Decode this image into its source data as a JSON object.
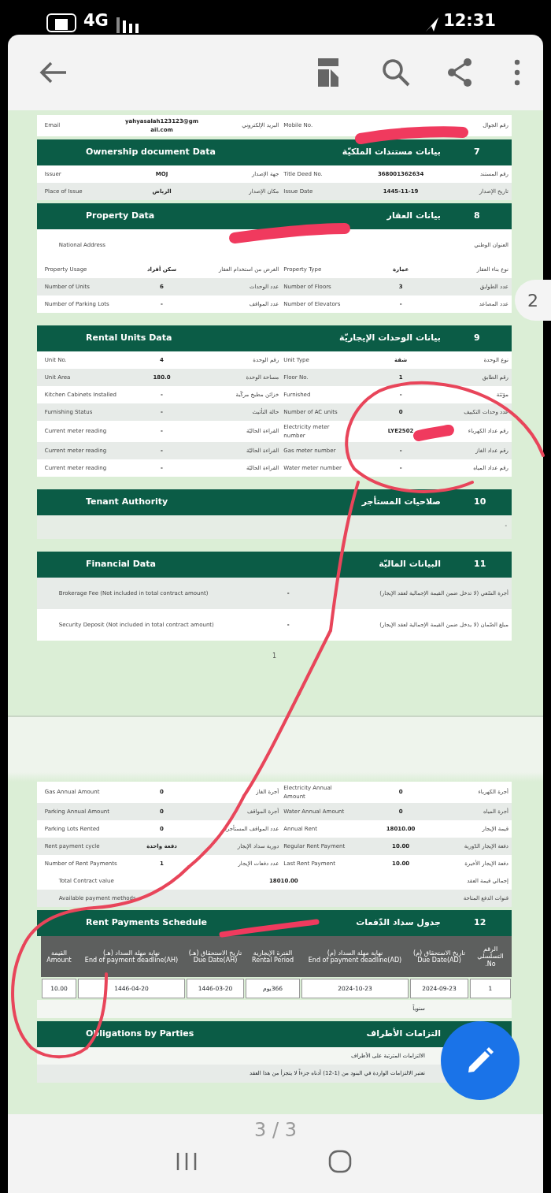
{
  "status_bar": {
    "network": "4G",
    "time": "12:31"
  },
  "pages": [
    {
      "blocks": [
        {
          "kind": "pair",
          "cells": [
            "رقم الجوال",
            null,
            "Mobile No.",
            "البريد الإلكتروني",
            "yahyasalah123123@gmail.com",
            "Email"
          ]
        },
        {
          "kind": "header",
          "number": "7",
          "title_ar": "بيانات مستندات الملكيّة",
          "title_en": "Ownership document Data"
        },
        {
          "kind": "pair",
          "cells": [
            "رقم المستند",
            "368001362634",
            "Title Deed No.",
            "جهة الإصدار",
            "MOJ",
            "Issuer"
          ]
        },
        {
          "kind": "pair",
          "cells": [
            "تاريخ الإصدار",
            "1445-11-19",
            "Issue Date",
            "مكان الإصدار",
            "الرياض",
            "Place of Issue"
          ]
        },
        {
          "kind": "header",
          "number": "8",
          "title_ar": "بيانات العقار",
          "title_en": "Property Data"
        },
        {
          "kind": "wide",
          "cells": [
            "العنوان الوطني",
            null,
            "National Address"
          ]
        },
        {
          "kind": "pair",
          "cells": [
            "نوع بناء العقار",
            "عمارة",
            "Property Type",
            "الغرض من استخدام العقار",
            "سكن أفراد",
            "Property Usage"
          ]
        },
        {
          "kind": "pair",
          "cells": [
            "عدد الطوابق",
            "3",
            "Number of Floors",
            "عدد الوحدات",
            "6",
            "Number of Units"
          ]
        },
        {
          "kind": "pair",
          "cells": [
            "عدد المصاعد",
            "-",
            "Number of Elevators",
            "عدد المواقف",
            "-",
            "Number of Parking Lots"
          ]
        },
        {
          "kind": "gap"
        },
        {
          "kind": "header",
          "number": "9",
          "title_ar": "بيانات الوحدات الإيجاريّة",
          "title_en": "Rental Units Data"
        },
        {
          "kind": "pair",
          "cells": [
            "نوع الوحدة",
            "شقة",
            "Unit Type",
            "رقم الوحدة",
            "4",
            "Unit No."
          ]
        },
        {
          "kind": "pair",
          "cells": [
            "رقم الطابق",
            "1",
            "Floor No.",
            "مساحة الوحدة",
            "180.0",
            "Unit Area"
          ]
        },
        {
          "kind": "pair",
          "cells": [
            "مؤثثة",
            "-",
            "Furnished",
            "خزائن مطبخ مركّبة",
            "-",
            "Kitchen Cabinets Installed"
          ]
        },
        {
          "kind": "pair",
          "cells": [
            "عدد وحدات التكييف",
            "0",
            "Number of AC units",
            "حالة التأثيث",
            "-",
            "Furnishing Status"
          ]
        },
        {
          "kind": "pair",
          "cells": [
            "رقم عداد الكهرباء",
            "LYE2502",
            "Electricity meter number",
            "القراءة الحاليّة",
            "-",
            "Current meter reading"
          ]
        },
        {
          "kind": "pair",
          "cells": [
            "رقم عداد الغاز",
            "-",
            "Gas meter number",
            "القراءة الحاليّة",
            "-",
            "Current meter reading"
          ]
        },
        {
          "kind": "pair",
          "cells": [
            "رقم عداد المياه",
            "-",
            "Water meter number",
            "القراءة الحاليّة",
            "-",
            "Current meter reading"
          ]
        },
        {
          "kind": "gap"
        },
        {
          "kind": "header",
          "number": "10",
          "title_ar": "صلاحيات المستأجر",
          "title_en": "Tenant Authority"
        },
        {
          "kind": "blank",
          "text": "-"
        },
        {
          "kind": "gap"
        },
        {
          "kind": "header",
          "number": "11",
          "title_ar": "البيانات الماليّة",
          "title_en": "Financial Data"
        },
        {
          "kind": "wide",
          "cells": [
            "أجرة السّعي (لا تدخل ضمن القيمة الإجمالية لعقد الإيجار)",
            "-",
            "Brokerage Fee (Not included in total contract amount)"
          ]
        },
        {
          "kind": "wide",
          "cells": [
            "مبلغ الضّمان (لا يدخل ضمن القيمة الإجمالية لعقد الإيجار)",
            "-",
            "Security Deposit (Not included in total contract amount)"
          ]
        }
      ],
      "page_number": "1"
    },
    {
      "blocks": [
        {
          "kind": "pair",
          "cells": [
            "أجرة الكهرباء",
            "0",
            "Electricity Annual Amount",
            "أجرة الغاز",
            "0",
            "Gas Annual Amount"
          ]
        },
        {
          "kind": "pair",
          "cells": [
            "أجرة المياه",
            "0",
            "Water Annual Amount",
            "أجرة المواقف",
            "0",
            "Parking Annual Amount"
          ]
        },
        {
          "kind": "pair",
          "cells": [
            "قيمة الإيجار",
            "18010.00",
            "Annual Rent",
            "عدد المواقف المستأجرة",
            "0",
            "Parking Lots Rented"
          ]
        },
        {
          "kind": "pair",
          "cells": [
            "دفعة الإيجار الدّورية",
            "10.00",
            "Regular Rent Payment",
            "دورية سداد الإيجار",
            "دفعة واحدة",
            "Rent payment cycle"
          ]
        },
        {
          "kind": "pair",
          "cells": [
            "دفعة الإيجار الأخيرة",
            "10.00",
            "Last Rent Payment",
            "عدد دفعات الإيجار",
            "1",
            "Number of Rent Payments"
          ]
        },
        {
          "kind": "total",
          "cells": [
            "إجمالي قيمة العقد",
            "18010.00",
            "Total Contract value"
          ]
        },
        {
          "kind": "total",
          "cells": [
            "قنوات الدفع المتاحة",
            null,
            "Available payment methods"
          ]
        },
        {
          "kind": "header",
          "number": "12",
          "title_ar": "جدول سداد الدّفعات",
          "title_en": "Rent Payments Schedule"
        },
        {
          "kind": "schedule",
          "columns": [
            {
              "ar": "الرقم التسلسلي",
              "en": "No."
            },
            {
              "ar": "تاريخ الاستحقاق (م)",
              "en": "Due Date(AD)"
            },
            {
              "ar": "نهاية مهلة السداد (م)",
              "en": "End of payment deadline(AD)"
            },
            {
              "ar": "الفترة الإيجارية",
              "en": "Rental Period"
            },
            {
              "ar": "تاريخ الاستحقاق (هـ)",
              "en": "Due Date(AH)"
            },
            {
              "ar": "نهاية مهلة السداد (هـ)",
              "en": "End of payment deadline(AH)"
            },
            {
              "ar": "القيمة",
              "en": "Amount"
            }
          ],
          "rows": [
            [
              "1",
              "2024-09-23",
              "2024-10-23",
              "366يوم",
              "1446-03-20",
              "1446-04-20",
              "10.00"
            ]
          ]
        },
        {
          "kind": "note",
          "text": "سنوياً"
        },
        {
          "kind": "header",
          "title_ar": "التزامات الأطراف",
          "title_en": "Obligations by Parties"
        },
        {
          "kind": "note",
          "text": "الالتزامات المترتبة على الأطراف"
        },
        {
          "kind": "note",
          "text": "تعتبر الالتزامات الواردة في البنود من (1-12) أدناه جزءاً لا يتجزأ من هذا العقد"
        }
      ]
    }
  ],
  "viewer": {
    "page_badge": "2",
    "page_indicator": "3 / 3"
  }
}
